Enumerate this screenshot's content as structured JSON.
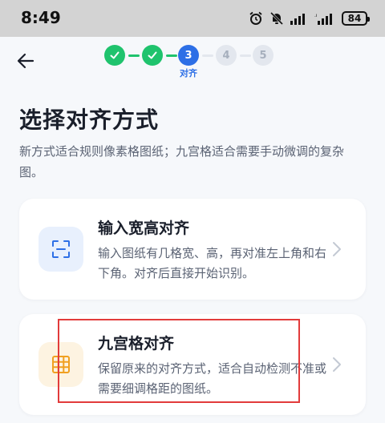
{
  "status_bar": {
    "time": "8:49",
    "battery": "84"
  },
  "stepper": {
    "steps": [
      {
        "state": "done",
        "label": ""
      },
      {
        "state": "done",
        "label": ""
      },
      {
        "state": "current",
        "number": "3",
        "label": "对齐"
      },
      {
        "state": "pending",
        "number": "4",
        "label": ""
      },
      {
        "state": "pending",
        "number": "5",
        "label": ""
      }
    ],
    "current_label": "对齐"
  },
  "page": {
    "title": "选择对齐方式",
    "subtitle": "新方式适合规则像素格图纸；九宫格适合需要手动微调的复杂图。"
  },
  "options": [
    {
      "title": "输入宽高对齐",
      "description": "输入图纸有几格宽、高，再对准左上角和右下角。对齐后直接开始识别。",
      "icon": "scan-frame-icon"
    },
    {
      "title": "九宫格对齐",
      "description": "保留原来的对齐方式，适合自动检测不准或需要细调格距的图纸。",
      "icon": "grid-icon"
    }
  ],
  "colors": {
    "accent": "#2d6fe6",
    "success": "#1fc36d",
    "highlight": "#e23b3b",
    "grid_icon": "#f0a020"
  }
}
